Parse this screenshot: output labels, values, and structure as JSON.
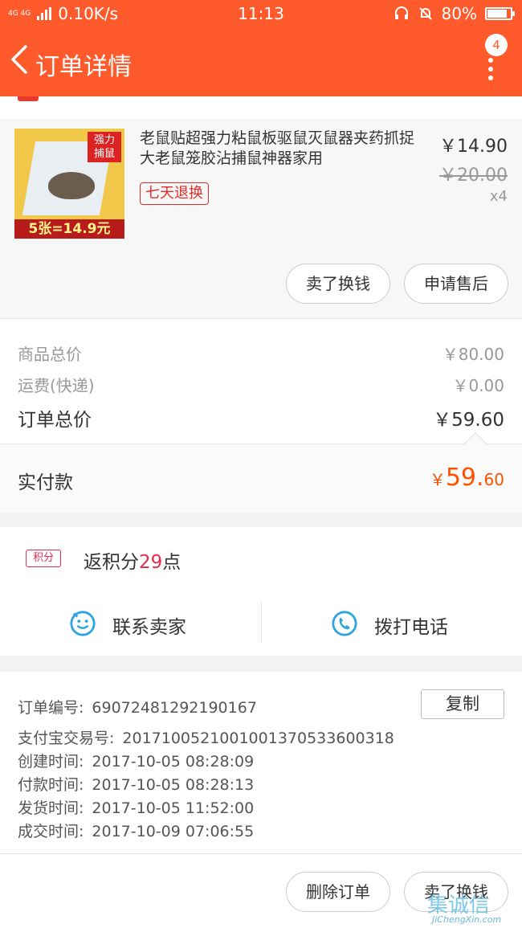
{
  "status_bar": {
    "network": "4G 4G",
    "speed": "0.10K/s",
    "time": "11:13",
    "battery": "80%"
  },
  "nav": {
    "title": "订单详情",
    "badge": "4"
  },
  "product": {
    "name": "老鼠贴超强力粘鼠板驱鼠灭鼠器夹药抓捉大老鼠笼胶沾捕鼠神器家用",
    "image_tag_line1": "强力",
    "image_tag_line2": "捕鼠",
    "image_banner": "5张=14.9元",
    "return_tag": "七天退换",
    "price": "￥14.90",
    "original_price": "￥20.00",
    "quantity": "x4",
    "buttons": {
      "sell": "卖了换钱",
      "after_sale": "申请售后"
    }
  },
  "summary": {
    "goods_total_label": "商品总价",
    "goods_total": "￥80.00",
    "shipping_label": "运费(快递)",
    "shipping": "￥0.00",
    "order_total_label": "订单总价",
    "order_total": "￥59.60"
  },
  "paid": {
    "label": "实付款",
    "currency": "￥",
    "integer": "59.",
    "decimal": "60"
  },
  "points": {
    "chip": "积分",
    "prefix": "返积分",
    "count": "29",
    "suffix": "点"
  },
  "contact": {
    "seller": "联系卖家",
    "phone": "拨打电话"
  },
  "order_info": {
    "copy": "复制",
    "rows": [
      {
        "label": "订单编号:",
        "value": "69072481292190167"
      },
      {
        "label": "支付宝交易号:",
        "value": "2017100521001001370533600318"
      },
      {
        "label": "创建时间:",
        "value": "2017-10-05 08:28:09"
      },
      {
        "label": "付款时间:",
        "value": "2017-10-05 08:28:13"
      },
      {
        "label": "发货时间:",
        "value": "2017-10-05 11:52:00"
      },
      {
        "label": "成交时间:",
        "value": "2017-10-09 07:06:55"
      }
    ]
  },
  "footer": {
    "delete": "删除订单",
    "sell": "卖了换钱"
  },
  "watermark": {
    "text": "集诚信",
    "url": "JiChengXin.com"
  },
  "colors": {
    "brand": "#ff5a2c",
    "paid": "#ff5000",
    "accent": "#e62b50",
    "icon": "#2fa5e0"
  }
}
